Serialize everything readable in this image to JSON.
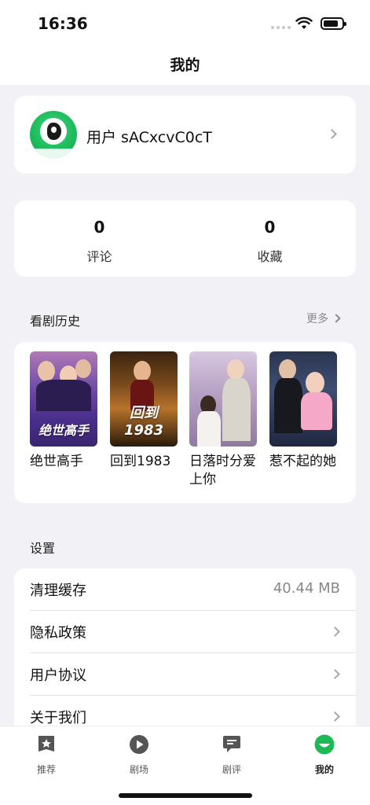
{
  "status_bar": {
    "time": "16:36"
  },
  "nav": {
    "title": "我的"
  },
  "profile": {
    "username": "用户 sACxcvC0cT"
  },
  "stats": [
    {
      "value": "0",
      "label": "评论"
    },
    {
      "value": "0",
      "label": "收藏"
    }
  ],
  "history": {
    "title": "看剧历史",
    "more_label": "更多",
    "items": [
      {
        "title": "绝世高手",
        "poster_text": "绝世高手"
      },
      {
        "title": "回到1983",
        "poster_text": "回到1983"
      },
      {
        "title": "日落时分爱上你",
        "poster_text": ""
      },
      {
        "title": "惹不起的她",
        "poster_text": ""
      }
    ]
  },
  "settings": {
    "title": "设置",
    "items": [
      {
        "label": "清理缓存",
        "value": "40.44 MB"
      },
      {
        "label": "隐私政策"
      },
      {
        "label": "用户协议"
      },
      {
        "label": "关于我们"
      }
    ]
  },
  "tabs": [
    {
      "label": "推荐",
      "icon": "star-badge-icon"
    },
    {
      "label": "剧场",
      "icon": "play-circle-icon"
    },
    {
      "label": "剧评",
      "icon": "chat-bubble-icon"
    },
    {
      "label": "我的",
      "icon": "profile-face-icon",
      "active": true
    }
  ],
  "colors": {
    "accent": "#1db954",
    "background": "#f2f2f6"
  }
}
